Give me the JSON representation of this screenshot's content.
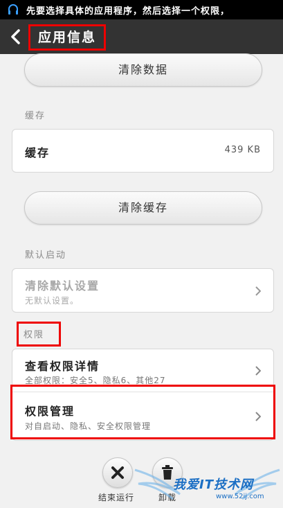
{
  "status_bar": {
    "text": "先要选择具体的应用程序，然后选择一个权限，"
  },
  "header": {
    "title": "应用信息"
  },
  "storage": {
    "clear_data_label": "清除数据"
  },
  "cache": {
    "section_label": "缓存",
    "row_title": "缓存",
    "row_value": "439 KB",
    "clear_cache_label": "清除缓存"
  },
  "defaults": {
    "section_label": "默认启动",
    "clear_title": "清除默认设置",
    "clear_subtitle": "无默认设置。"
  },
  "permissions": {
    "section_label": "权限",
    "details_title": "查看权限详情",
    "details_subtitle": "全部权限：安全5、隐私6、其他27",
    "manage_title": "权限管理",
    "manage_subtitle": "对自启动、隐私、安全权限管理"
  },
  "bottom_bar": {
    "force_stop_label": "结束运行",
    "uninstall_label": "卸载"
  },
  "watermark": {
    "text": "我爱IT技术网",
    "url": "www.52ij.com"
  },
  "colors": {
    "highlight": "#e00000",
    "title_bar": "#333333",
    "watermark": "#1c6fc4"
  }
}
